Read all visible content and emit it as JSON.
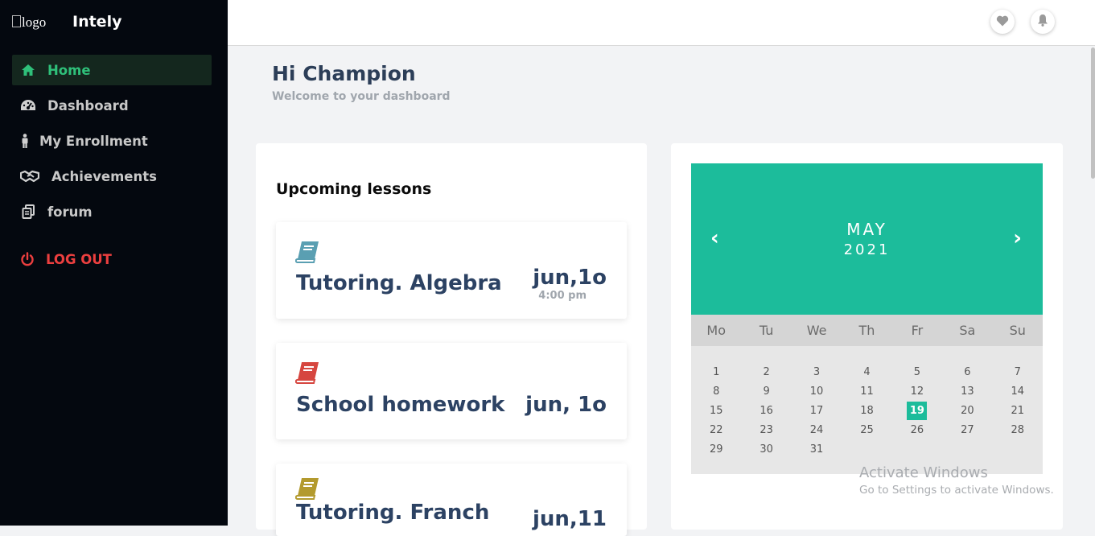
{
  "brand": {
    "logo_alt": "logo",
    "name": "Intely"
  },
  "sidebar": {
    "items": [
      {
        "label": "Home",
        "icon": "home-icon"
      },
      {
        "label": "Dashboard",
        "icon": "speedometer-icon"
      },
      {
        "label": "My Enrollment",
        "icon": "person-icon"
      },
      {
        "label": "Achievements",
        "icon": "handshake-icon"
      },
      {
        "label": "forum",
        "icon": "copy-icon"
      }
    ],
    "logout": {
      "label": "LOG OUT",
      "icon": "power-icon"
    }
  },
  "topbar": {
    "icons": [
      "heart-icon",
      "bell-icon"
    ]
  },
  "header": {
    "greeting": "Hi Champion",
    "subtitle": "Welcome to your dashboard"
  },
  "lessons": {
    "title": "Upcoming lessons",
    "items": [
      {
        "name": "Tutoring. Algebra",
        "date": "jun,1o",
        "time": "4:00 pm",
        "book_color": "#5a9fb2"
      },
      {
        "name": "School homework",
        "date": "jun, 1o",
        "book_color": "#d6463f"
      },
      {
        "name": "Tutoring. Franch",
        "date": "jun,11",
        "book_color": "#b39a2e"
      }
    ]
  },
  "calendar": {
    "month": "MAY",
    "year": "2021",
    "prev": "‹",
    "next": "›",
    "weekdays": [
      "Mo",
      "Tu",
      "We",
      "Th",
      "Fr",
      "Sa",
      "Su"
    ],
    "days": [
      1,
      2,
      3,
      4,
      5,
      6,
      7,
      8,
      9,
      10,
      11,
      12,
      13,
      14,
      15,
      16,
      17,
      18,
      19,
      20,
      21,
      22,
      23,
      24,
      25,
      26,
      27,
      28,
      29,
      30,
      31
    ],
    "selected": 19,
    "accent": "#1cbc9b"
  },
  "watermark": {
    "line1": "Activate Windows",
    "line2": "Go to Settings to activate Windows."
  },
  "colors": {
    "sidebar_bg": "#04080f",
    "active_nav": "#2fc07a",
    "logout": "#ec3f3f",
    "heading": "#2c3e58"
  }
}
